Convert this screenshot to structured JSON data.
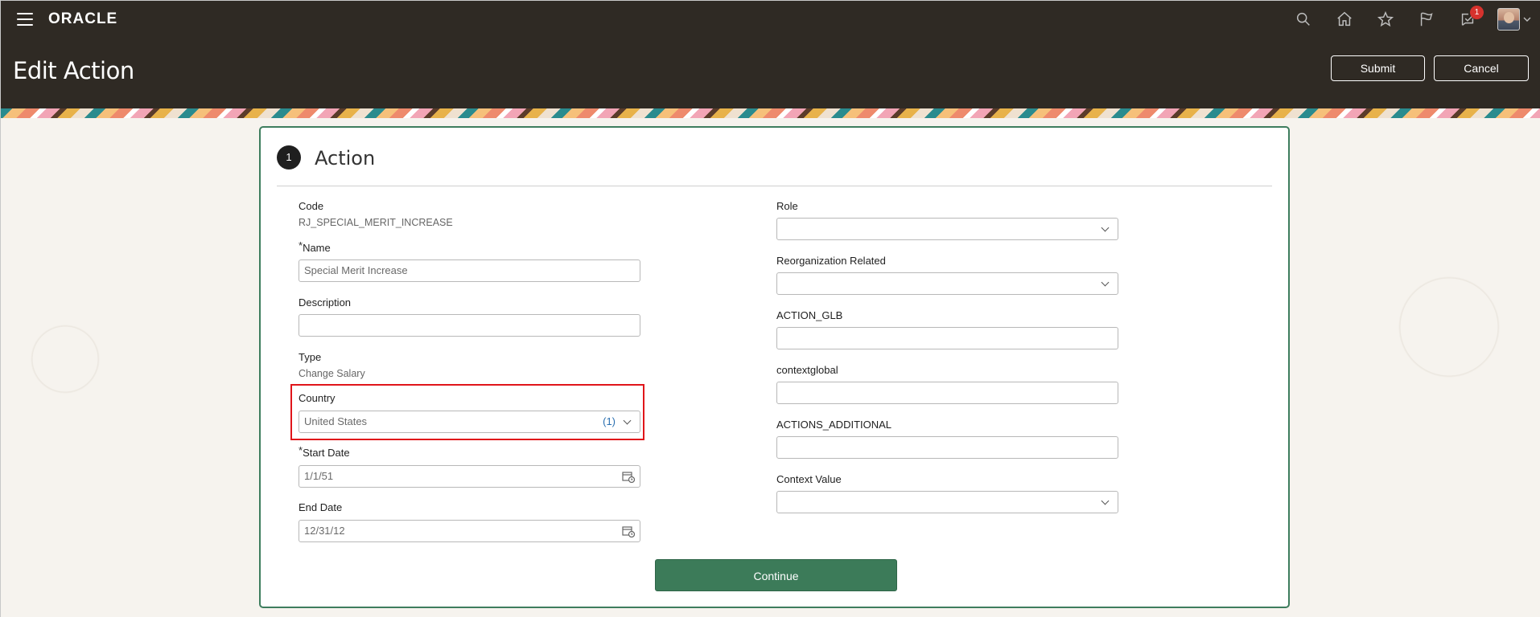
{
  "header": {
    "logo": "ORACLE",
    "page_title": "Edit Action",
    "submit_label": "Submit",
    "cancel_label": "Cancel",
    "notification_count": "1",
    "icons": [
      "search-icon",
      "home-icon",
      "star-icon",
      "flag-icon",
      "notifications-icon",
      "avatar"
    ]
  },
  "section": {
    "step_number": "1",
    "title": "Action"
  },
  "left_fields": {
    "code_label": "Code",
    "code_value": "RJ_SPECIAL_MERIT_INCREASE",
    "name_required": "*",
    "name_label": "Name",
    "name_value": "Special Merit Increase",
    "description_label": "Description",
    "description_value": "",
    "type_label": "Type",
    "type_value": "Change Salary",
    "country_label": "Country",
    "country_value": "United States",
    "country_count": "(1)",
    "start_date_required": "*",
    "start_date_label": "Start Date",
    "start_date_value": "1/1/51",
    "end_date_label": "End Date",
    "end_date_value": "12/31/12"
  },
  "right_fields": {
    "role_label": "Role",
    "role_value": "",
    "reorg_label": "Reorganization Related",
    "reorg_value": "",
    "action_glb_label": "ACTION_GLB",
    "action_glb_value": "",
    "contextglobal_label": "contextglobal",
    "contextglobal_value": "",
    "actions_additional_label": "ACTIONS_ADDITIONAL",
    "actions_additional_value": "",
    "context_value_label": "Context Value",
    "context_value_value": ""
  },
  "footer": {
    "continue_label": "Continue"
  },
  "colors": {
    "header_bg": "#2f2a24",
    "accent_green": "#3c7b59",
    "highlight_red": "#e0151a",
    "badge_red": "#d6322d"
  }
}
